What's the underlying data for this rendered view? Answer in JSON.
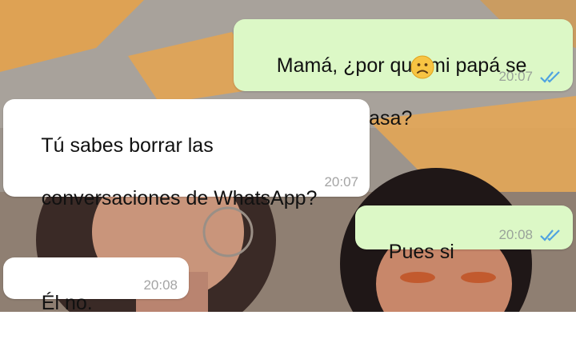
{
  "chat": {
    "messages": [
      {
        "direction": "outgoing",
        "lines": [
          "Mamá, ¿por qué mi papá se",
          "fué de la casa?"
        ],
        "emoji": "worried-face",
        "time": "20:07",
        "status": "read"
      },
      {
        "direction": "incoming",
        "lines": [
          "Tú sabes borrar las",
          "conversaciones de WhatsApp?"
        ],
        "time": "20:07"
      },
      {
        "direction": "outgoing",
        "lines": [
          "Pues si"
        ],
        "time": "20:08",
        "status": "read"
      },
      {
        "direction": "incoming",
        "lines": [
          "Él no."
        ],
        "time": "20:08"
      }
    ]
  },
  "colors": {
    "outgoing_bubble": "#dcf8c6",
    "incoming_bubble": "#ffffff",
    "read_checks": "#4fa3e0",
    "timestamp": "#9aa39a"
  }
}
